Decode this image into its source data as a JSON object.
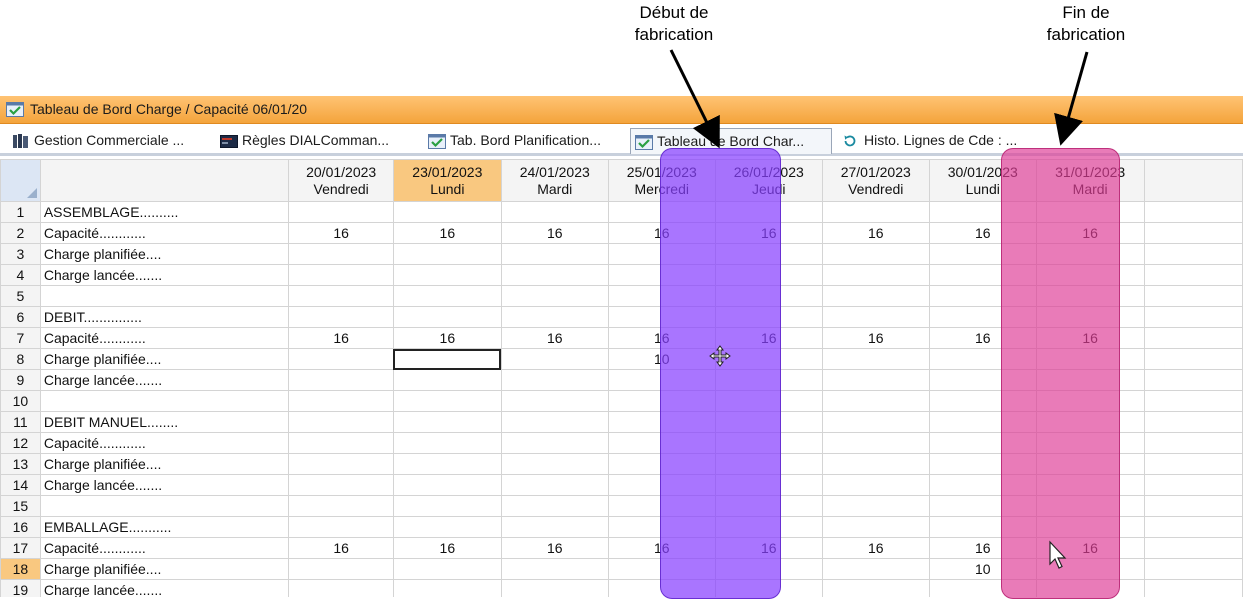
{
  "annotations": {
    "start": "Début de\nfabrication",
    "end": "Fin de\nfabrication"
  },
  "window": {
    "title": "Tableau de Bord Charge / Capacité 06/01/20"
  },
  "tabs": [
    {
      "label": "Gestion Commerciale ...",
      "icon": "books-icon"
    },
    {
      "label": "Règles DIALComman...",
      "icon": "terminal-icon"
    },
    {
      "label": "Tab. Bord Planification...",
      "icon": "checkmark-window-icon"
    },
    {
      "label": "Tableau de Bord Char...",
      "icon": "checkmark-window-icon",
      "active": true
    },
    {
      "label": "Histo. Lignes de Cde : ...",
      "icon": "history-icon"
    }
  ],
  "columns": [
    {
      "date": "20/01/2023",
      "day": "Vendredi"
    },
    {
      "date": "23/01/2023",
      "day": "Lundi",
      "highlight": true
    },
    {
      "date": "24/01/2023",
      "day": "Mardi"
    },
    {
      "date": "25/01/2023",
      "day": "Mercredi"
    },
    {
      "date": "26/01/2023",
      "day": "Jeudi"
    },
    {
      "date": "27/01/2023",
      "day": "Vendredi"
    },
    {
      "date": "30/01/2023",
      "day": "Lundi"
    },
    {
      "date": "31/01/2023",
      "day": "Mardi"
    }
  ],
  "rows": [
    {
      "n": "1",
      "label": "ASSEMBLAGE..........",
      "values": [
        "",
        "",
        "",
        "",
        "",
        "",
        "",
        ""
      ]
    },
    {
      "n": "2",
      "label": "Capacité............",
      "values": [
        "16",
        "16",
        "16",
        "16",
        "16",
        "16",
        "16",
        "16"
      ]
    },
    {
      "n": "3",
      "label": "Charge planifiée....",
      "values": [
        "",
        "",
        "",
        "",
        "",
        "",
        "",
        ""
      ]
    },
    {
      "n": "4",
      "label": "Charge lancée.......",
      "values": [
        "",
        "",
        "",
        "",
        "",
        "",
        "",
        ""
      ]
    },
    {
      "n": "5",
      "label": "",
      "values": [
        "",
        "",
        "",
        "",
        "",
        "",
        "",
        ""
      ]
    },
    {
      "n": "6",
      "label": "DEBIT...............",
      "values": [
        "",
        "",
        "",
        "",
        "",
        "",
        "",
        ""
      ]
    },
    {
      "n": "7",
      "label": "Capacité............",
      "values": [
        "16",
        "16",
        "16",
        "16",
        "16",
        "16",
        "16",
        "16"
      ]
    },
    {
      "n": "8",
      "label": "Charge planifiée....",
      "values": [
        "",
        "",
        "",
        "10",
        "",
        "",
        "",
        ""
      ]
    },
    {
      "n": "9",
      "label": "Charge lancée.......",
      "values": [
        "",
        "",
        "",
        "",
        "",
        "",
        "",
        ""
      ]
    },
    {
      "n": "10",
      "label": "",
      "values": [
        "",
        "",
        "",
        "",
        "",
        "",
        "",
        ""
      ]
    },
    {
      "n": "11",
      "label": "DEBIT MANUEL........",
      "values": [
        "",
        "",
        "",
        "",
        "",
        "",
        "",
        ""
      ]
    },
    {
      "n": "12",
      "label": "Capacité............",
      "values": [
        "",
        "",
        "",
        "",
        "",
        "",
        "",
        ""
      ]
    },
    {
      "n": "13",
      "label": "Charge planifiée....",
      "values": [
        "",
        "",
        "",
        "",
        "",
        "",
        "",
        ""
      ]
    },
    {
      "n": "14",
      "label": "Charge lancée.......",
      "values": [
        "",
        "",
        "",
        "",
        "",
        "",
        "",
        ""
      ]
    },
    {
      "n": "15",
      "label": "",
      "values": [
        "",
        "",
        "",
        "",
        "",
        "",
        "",
        ""
      ]
    },
    {
      "n": "16",
      "label": "EMBALLAGE...........",
      "values": [
        "",
        "",
        "",
        "",
        "",
        "",
        "",
        ""
      ]
    },
    {
      "n": "17",
      "label": "Capacité............",
      "values": [
        "16",
        "16",
        "16",
        "16",
        "16",
        "16",
        "16",
        "16"
      ]
    },
    {
      "n": "18",
      "label": "Charge planifiée....",
      "values": [
        "",
        "",
        "",
        "",
        "",
        "",
        "10",
        ""
      ],
      "highlight": true
    },
    {
      "n": "19",
      "label": "Charge lancée.......",
      "values": [
        "",
        "",
        "",
        "",
        "",
        "",
        "",
        ""
      ]
    }
  ],
  "colors": {
    "title_bar": "#f4a43c",
    "highlight": "#f9c880",
    "start_overlay": "#8840ff",
    "end_overlay": "#de3c96"
  }
}
